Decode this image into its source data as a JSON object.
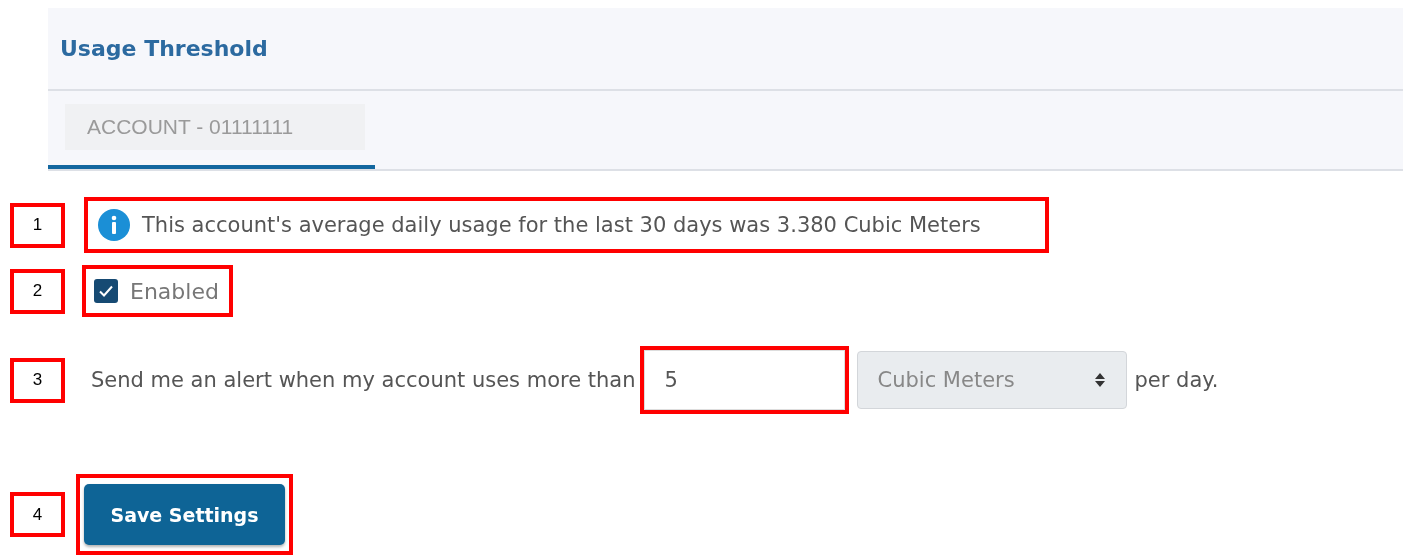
{
  "header": {
    "title": "Usage Threshold"
  },
  "tabs": [
    {
      "label": "ACCOUNT - 01111111",
      "selected": true
    }
  ],
  "info": {
    "text": "This account's average daily usage for the last 30 days was 3.380 Cubic Meters"
  },
  "enabled": {
    "label": "Enabled",
    "checked": true
  },
  "alert": {
    "prefix": "Send me an alert when my account uses more than",
    "value": "5",
    "unit": "Cubic Meters",
    "suffix": "per day."
  },
  "save_button": {
    "label": "Save Settings"
  },
  "annotations": [
    {
      "number": "1"
    },
    {
      "number": "2"
    },
    {
      "number": "3"
    },
    {
      "number": "4"
    }
  ]
}
